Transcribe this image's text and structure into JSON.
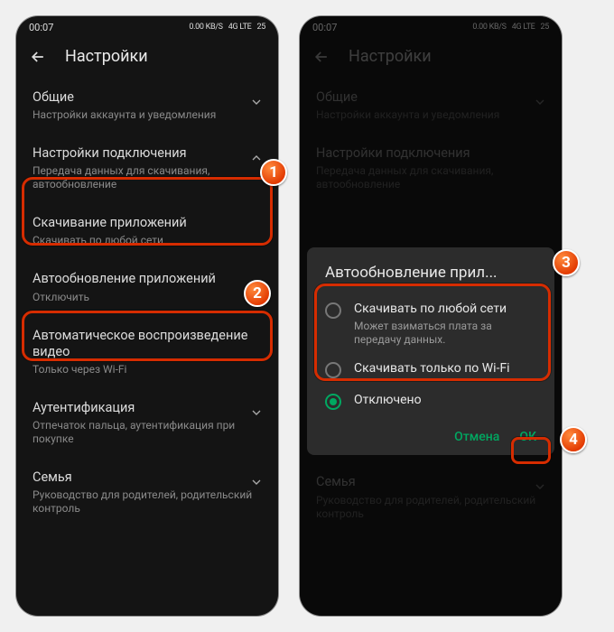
{
  "status": {
    "time": "00:07",
    "net": "0.00 KB/S",
    "sig": "4G LTE",
    "batt": "25"
  },
  "header": {
    "title": "Настройки"
  },
  "sections": {
    "general": {
      "t": "Общие",
      "s": "Настройки аккаунта и уведомления"
    },
    "conn": {
      "t": "Настройки подключения",
      "s": "Передача данных для скачивания, автообновление"
    },
    "download": {
      "t": "Скачивание приложений",
      "s": "Скачивать по любой сети"
    },
    "autoupd": {
      "t": "Автообновление приложений",
      "s": "Отключить"
    },
    "autoplay": {
      "t": "Автоматическое воспроизведение видео",
      "s": "Только через Wi-Fi"
    },
    "auth": {
      "t": "Аутентификация",
      "s": "Отпечаток пальца, аутентификация при покупке"
    },
    "family": {
      "t": "Семья",
      "s": "Руководство для родителей, родительский контроль"
    }
  },
  "dialog": {
    "title": "Автообновление прил...",
    "opt1": {
      "t": "Скачивать по любой сети",
      "s": "Может взиматься плата за передачу данных."
    },
    "opt2": {
      "t": "Скачивать только по Wi-Fi"
    },
    "opt3": {
      "t": "Отключено"
    },
    "cancel": "Отмена",
    "ok": "ОК"
  },
  "badges": {
    "b1": "1",
    "b2": "2",
    "b3": "3",
    "b4": "4"
  }
}
